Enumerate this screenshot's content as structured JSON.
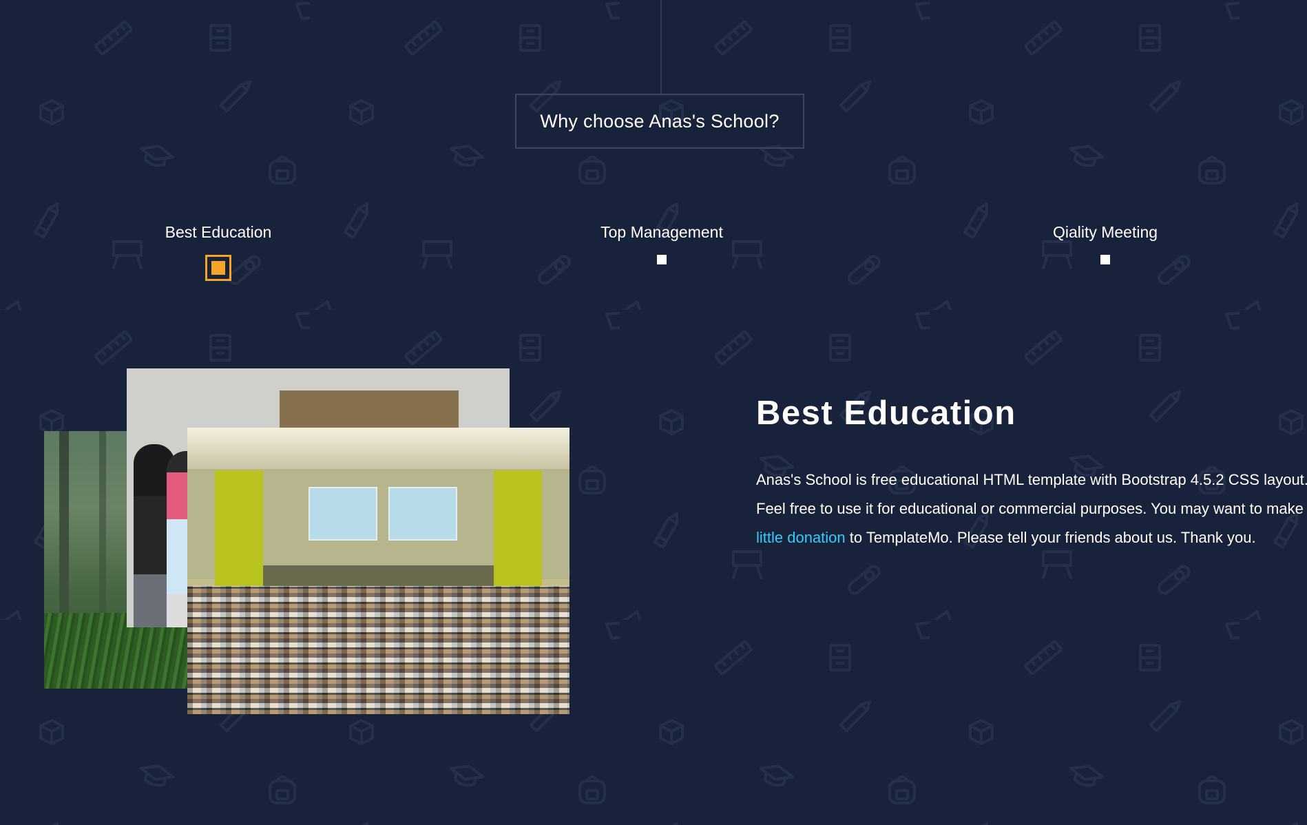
{
  "section": {
    "title": "Why choose Anas's School?"
  },
  "tabs": [
    {
      "label": "Best Education",
      "active": true
    },
    {
      "label": "Top Management",
      "active": false
    },
    {
      "label": "Qiality Meeting",
      "active": false
    }
  ],
  "content": {
    "heading": "Best Education",
    "text_before_link": "Anas's School is free educational HTML template with Bootstrap 4.5.2 CSS layout. Feel free to use it for educational or commercial purposes. You may want to make ",
    "link_text": "a little donation",
    "text_after_link": " to TemplateMo. Please tell your friends about us. Thank you."
  },
  "colors": {
    "background": "#18223a",
    "accent": "#f5a425",
    "link": "#33ccff",
    "pattern": "#243049"
  },
  "background_icons": [
    "ruler-icon",
    "locker-icon",
    "cube-icon",
    "pencil-icon",
    "graduation-cap-icon",
    "backpack-icon",
    "easel-icon",
    "diploma-icon",
    "book-icon"
  ]
}
